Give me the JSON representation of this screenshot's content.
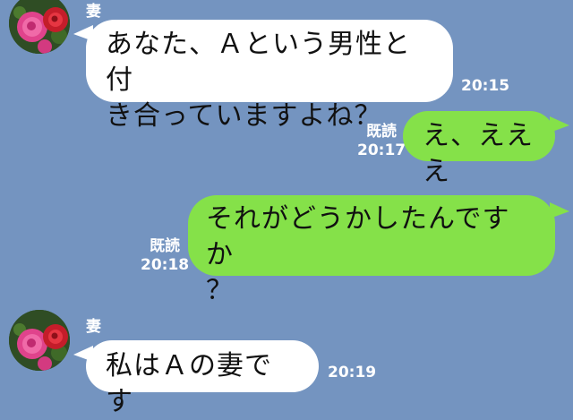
{
  "colors": {
    "background": "#7494c0",
    "incoming_bubble": "#ffffff",
    "outgoing_bubble": "#85e149"
  },
  "messages": [
    {
      "sender": "妻",
      "side": "in",
      "avatar": "rose-avatar-icon",
      "line1": "あなた、Ａという男性と付",
      "line2": "き合っていますよね？",
      "time": "20:15"
    },
    {
      "side": "out",
      "read": "既読",
      "text": "え、えええ",
      "time": "20:17"
    },
    {
      "side": "out",
      "read": "既読",
      "line1": "それがどうかしたんですか",
      "line2": "？",
      "time": "20:18"
    },
    {
      "sender": "妻",
      "side": "in",
      "avatar": "rose-avatar-icon",
      "text": "私はＡの妻です",
      "time": "20:19"
    }
  ]
}
